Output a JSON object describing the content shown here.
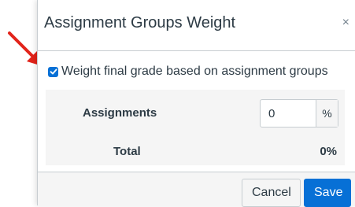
{
  "dialog": {
    "title": "Assignment Groups Weight",
    "close_glyph": "×"
  },
  "checkbox": {
    "label": "Weight final grade based on assignment groups",
    "checked": true
  },
  "groups": [
    {
      "name": "Assignments",
      "weight": "0",
      "unit": "%"
    }
  ],
  "total": {
    "label": "Total",
    "value": "0%"
  },
  "footer": {
    "cancel_label": "Cancel",
    "save_label": "Save"
  },
  "colors": {
    "accent": "#0770d6",
    "annotation_arrow": "#e2231a"
  },
  "icons": {
    "annotation": "red-arrow-icon",
    "check": "checkmark-icon",
    "close": "close-icon"
  }
}
